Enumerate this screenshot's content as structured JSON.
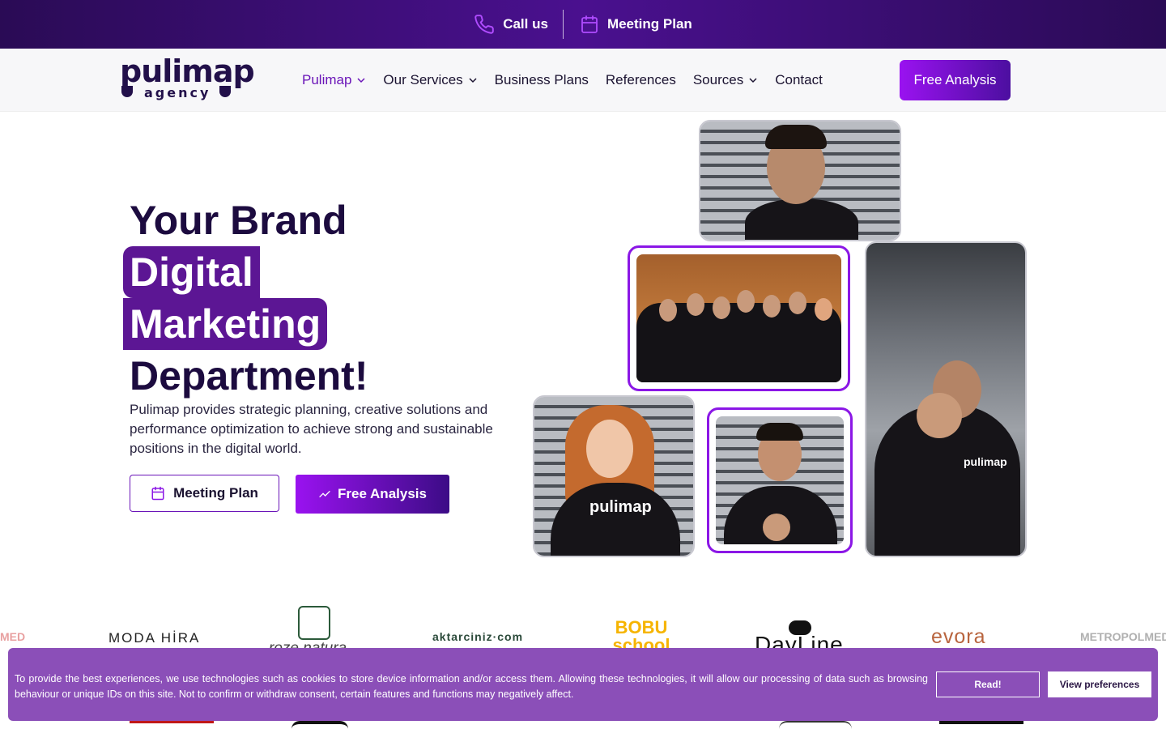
{
  "topbar": {
    "call_label": "Call us",
    "meeting_label": "Meeting Plan"
  },
  "nav": {
    "logo_main": "pulimap",
    "logo_sub": "agency",
    "items": [
      {
        "label": "Pulimap",
        "dropdown": true,
        "active": true
      },
      {
        "label": "Our Services",
        "dropdown": true
      },
      {
        "label": "Business Plans",
        "dropdown": false
      },
      {
        "label": "References",
        "dropdown": false
      },
      {
        "label": "Sources",
        "dropdown": true
      },
      {
        "label": "Contact",
        "dropdown": false
      }
    ],
    "cta_label": "Free Analysis"
  },
  "hero": {
    "title_line1": "Your Brand",
    "title_line2": "Digital",
    "title_line3": "Marketing",
    "title_line4": "Department!",
    "description": "Pulimap provides strategic planning, creative solutions and performance optimization to achieve strong and sustainable positions in the digital world.",
    "meeting_button": "Meeting Plan",
    "free_button": "Free Analysis"
  },
  "photos": {
    "brand_mark": "pulimap"
  },
  "logos": [
    "MED",
    "MODA HİRA",
    "roze natura",
    "aktarciniz·com",
    "BOBU school",
    "DayLine",
    "evora",
    "METROPOLMED"
  ],
  "cookie": {
    "text": "To provide the best experiences, we use technologies such as cookies to store device information and/or access them. Allowing these technologies, it will allow our processing of data such as browsing behaviour or unique IDs on this site. Not to confirm or withdraw consent, certain features and functions may negatively affect.",
    "read_label": "Read!",
    "preferences_label": "View preferences"
  },
  "colors": {
    "brand_purple": "#8b17e6",
    "dark_navy": "#1c0b3f",
    "cookie_bg": "#8b4fb8"
  }
}
